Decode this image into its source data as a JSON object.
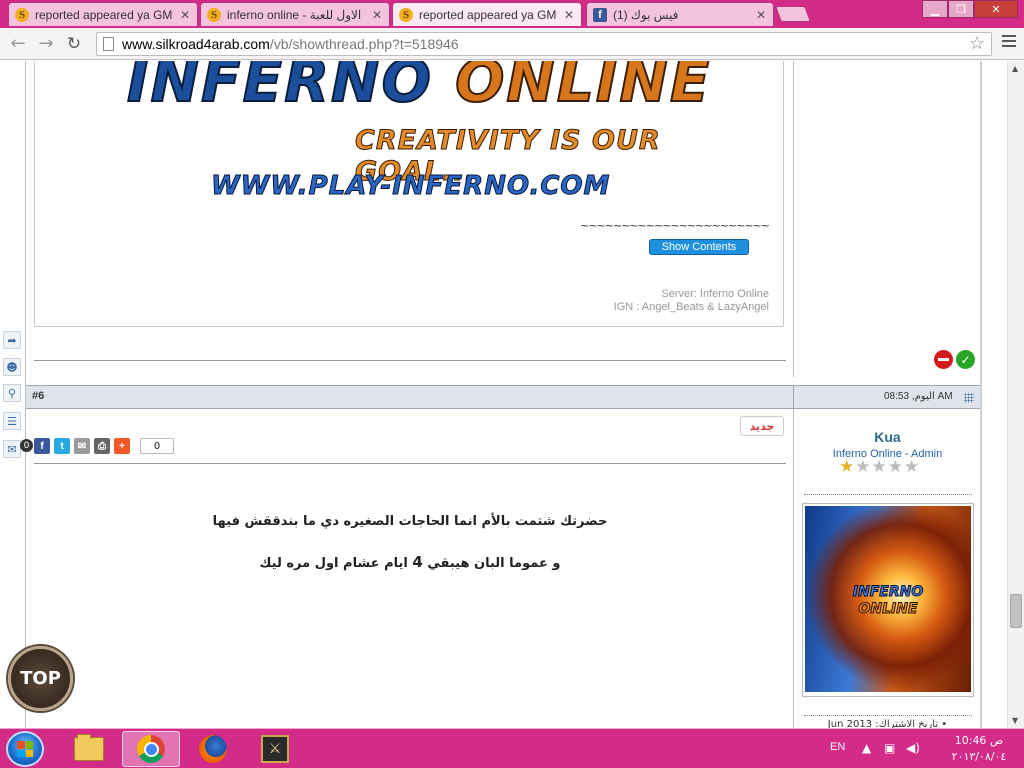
{
  "browser": {
    "tabs": [
      {
        "title": "reported appeared ya GM",
        "icon": "silkroad-icon",
        "active": false
      },
      {
        "title": "inferno online - الاول للعبة",
        "icon": "silkroad-icon",
        "active": false
      },
      {
        "title": "reported appeared ya GM",
        "icon": "silkroad-icon",
        "active": true
      },
      {
        "title": "(1) فيس بوك",
        "icon": "facebook-icon",
        "active": false
      }
    ],
    "url_host": "www.silkroad4arab.com",
    "url_path": "/vb/showthread.php?t=518946"
  },
  "post1": {
    "banner_word1": "INFERNO",
    "banner_word2": "ONLINE",
    "banner_slogan": "CREATIVITY IS OUR GOAL...",
    "banner_url": "WWW.PLAY-INFERNO.COM",
    "divider_text": "~~~~~~~~~~~~~~~~~~~~~~~",
    "show_contents_label": "Show Contents",
    "sig_server": "Server: Inferno Online",
    "sig_ign": "IGN : Angel_Beats & LazyAngel"
  },
  "post2": {
    "number": "#6",
    "date": "اليوم, 08:53 AM",
    "new_badge": "جديد",
    "share_count": "0",
    "text_line1": "حضرتك شتمت بالأم انما الحاجات الصغيره دي ما بندققش فيها",
    "text_line2_part1": "و عموما البان هيبقي ",
    "text_line2_num": "4",
    "text_line2_part2": " ايام عشام اول مره ليك",
    "username": "Kua",
    "user_title": "Inferno Online - Admin",
    "rating_stars": 1,
    "rating_max": 5,
    "avatar_line1": "INFERNO",
    "avatar_line2": "ONLINE",
    "join_date": "• تاريخ الاشتراك: Jun 2013"
  },
  "sidebar": {
    "message_count": "0"
  },
  "top_button": "TOP",
  "taskbar": {
    "language": "EN",
    "time": "10:46 ص",
    "date": "٢٠١٣/٠٨/٠٤"
  },
  "colors": {
    "taskbar_pink": "#d42a88",
    "link_blue": "#2261a8",
    "show_contents_blue": "#1f8fe0"
  }
}
